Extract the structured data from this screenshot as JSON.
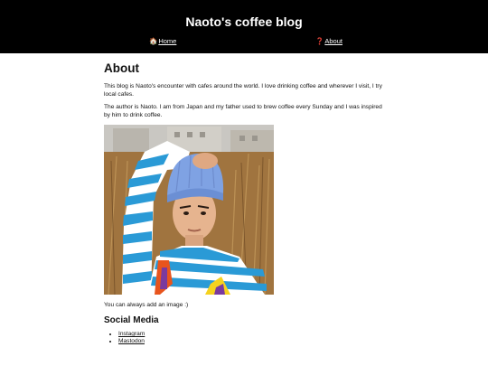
{
  "header": {
    "site_title": "Naoto's coffee blog",
    "nav": {
      "home_icon": "🏠",
      "home_label": "Home",
      "about_icon": "❓",
      "about_label": "About"
    }
  },
  "main": {
    "heading": "About",
    "paragraph_1": "This blog is Naoto's encounter with cafes around the world. I love drinking coffee and wherever I visit, I try local cafes.",
    "paragraph_2": "The author is Naoto. I am from Japan and my father used to brew coffee every Sunday and I was inspired by him to drink coffee.",
    "image_alt": "Naoto",
    "caption": "You can always add an image :)",
    "social_heading": "Social Media",
    "social_links": [
      "Instagram",
      "Mastodon"
    ]
  },
  "colors": {
    "header_bg": "#000000",
    "header_text": "#ffffff",
    "page_bg": "#ffffff"
  }
}
